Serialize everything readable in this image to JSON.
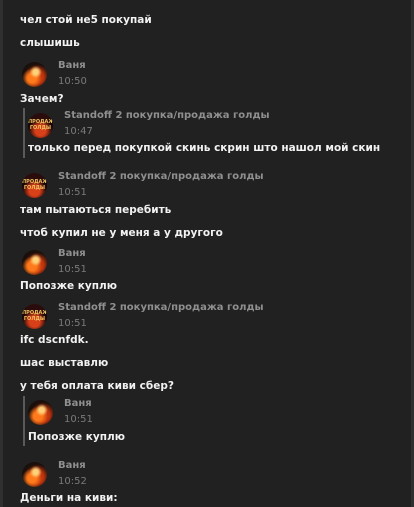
{
  "messages": {
    "m1": "чел стой не5 покупай",
    "m2": "слышишь",
    "h1_name": "Ваня",
    "h1_time": "10:50",
    "m3": "Зачем?",
    "q1_name": "Standoff 2 покупка/продажа голды",
    "q1_time": "10:47",
    "q1_text": "только перед покупкой скинь скрин што нашол мой скин",
    "h2_name": "Standoff 2 покупка/продажа голды",
    "h2_time": "10:51",
    "m4": "там пытаються перебить",
    "m5": "чтоб купил не у меня а у другого",
    "h3_name": "Ваня",
    "h3_time": "10:51",
    "m6": "Попозже куплю",
    "h4_name": "Standoff 2 покупка/продажа голды",
    "h4_time": "10:51",
    "m7": "ifc dscnfdk.",
    "m8": "шас выставлю",
    "m9": "у тебя оплата киви сбер?",
    "q2_name": "Ваня",
    "q2_time": "10:51",
    "q2_text": "Попозже куплю",
    "h5_name": "Ваня",
    "h5_time": "10:52",
    "m10": "Деньги на киви:"
  },
  "avatars": {
    "standoff_logo_text": "ПРОДАЖА ГОЛДЫ"
  },
  "colors": {
    "background": "#212121",
    "text": "#f2f2f2",
    "author": "#8f8f8f",
    "time": "#7a7a7a",
    "quote_bar": "#5a5a5a"
  }
}
